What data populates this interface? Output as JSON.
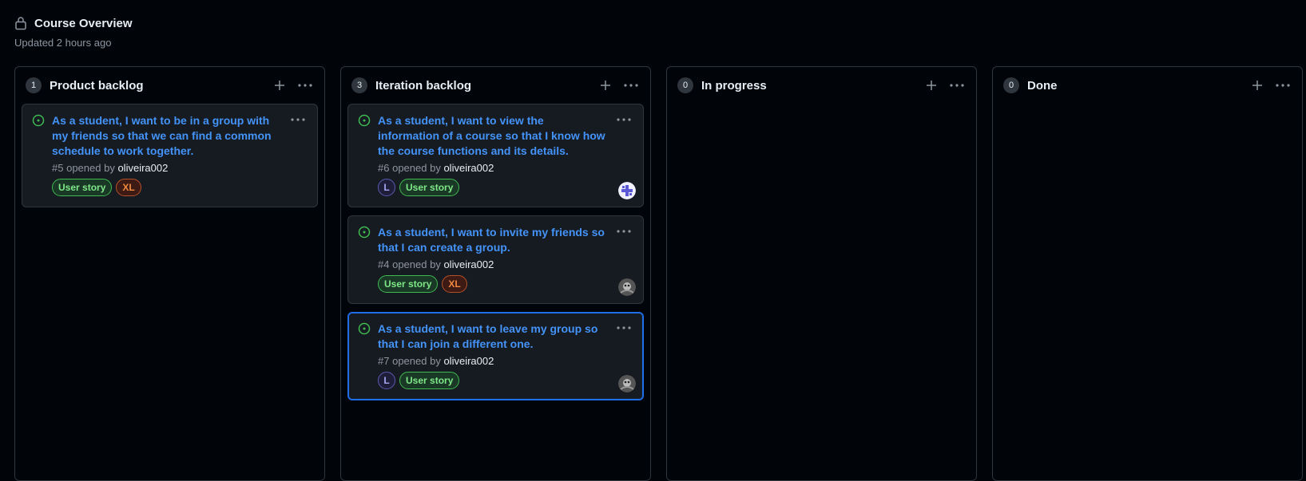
{
  "header": {
    "title": "Course Overview",
    "updated": "Updated 2 hours ago",
    "icon": "lock-icon"
  },
  "columns": [
    {
      "count": "1",
      "name": "Product backlog",
      "cards": [
        {
          "title": "As a student, I want to be in a group with my friends so that we can find a common schedule to work together.",
          "number": "#5",
          "opened_by": "opened by",
          "author": "oliveira002",
          "labels": [
            "User story",
            "XL"
          ]
        }
      ]
    },
    {
      "count": "3",
      "name": "Iteration backlog",
      "cards": [
        {
          "title": "As a student, I want to view the information of a course so that I know how the course functions and its details.",
          "number": "#6",
          "opened_by": "opened by",
          "author": "oliveira002",
          "labels": [
            "L",
            "User story"
          ]
        },
        {
          "title": "As a student, I want to invite my friends so that I can create a group.",
          "number": "#4",
          "opened_by": "opened by",
          "author": "oliveira002",
          "labels": [
            "User story",
            "XL"
          ]
        },
        {
          "title": "As a student, I want to leave my group so that I can join a different one.",
          "number": "#7",
          "opened_by": "opened by",
          "author": "oliveira002",
          "labels": [
            "L",
            "User story"
          ]
        }
      ]
    },
    {
      "count": "0",
      "name": "In progress"
    },
    {
      "count": "0",
      "name": "Done"
    }
  ],
  "colors": {
    "background": "#010409",
    "card": "#161b22",
    "link": "#4493f8",
    "open_icon": "#3fb950",
    "selected_border": "#1f6feb"
  }
}
